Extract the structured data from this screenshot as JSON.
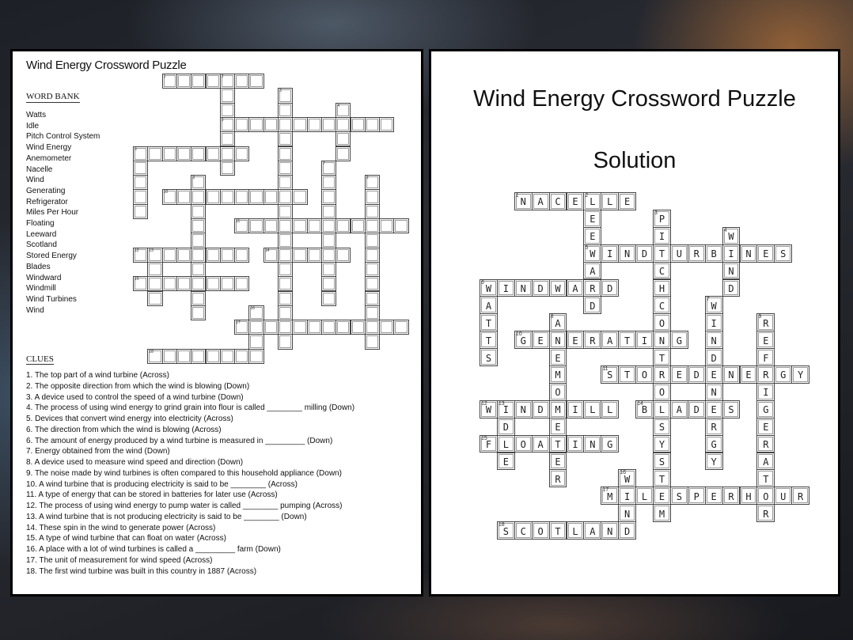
{
  "puzzle": {
    "title": "Wind Energy Crossword Puzzle",
    "word_bank_heading": "WORD BANK",
    "word_bank": [
      "Watts",
      "Idle",
      "Pitch Control System",
      "Wind Energy",
      "Anemometer",
      "Nacelle",
      "Wind",
      "Generating",
      "Refrigerator",
      "Miles Per Hour",
      "Floating",
      "Leeward",
      "Scotland",
      "Stored Energy",
      "Blades",
      "Windward",
      "Windmill",
      "Wind Turbines",
      "Wind"
    ],
    "clues_heading": "CLUES",
    "clues": [
      "1. The top part of a wind turbine (Across)",
      "2. The opposite direction from which the wind is blowing (Down)",
      "3. A device used to control the speed of a wind turbine (Down)",
      "4. The process of using wind energy to grind grain into flour is called ________ milling (Down)",
      "5. Devices that convert wind energy into electricity (Across)",
      "6. The direction from which the wind is blowing (Across)",
      "6. The amount of energy produced by a wind turbine is measured in _________ (Down)",
      "7. Energy obtained from the wind (Down)",
      "8. A device used to measure wind speed and direction (Down)",
      "9. The noise made by wind turbines is often compared to this household appliance (Down)",
      "10. A wind turbine that is producing electricity is said to be ________ (Across)",
      "11. A type of energy that can be stored in batteries for later use (Across)",
      "12. The process of using wind energy to pump water is called ________ pumping (Across)",
      "13. A wind turbine that is not producing electricity is said to be ________ (Down)",
      "14. These spin in the wind to generate power (Across)",
      "15. A type of wind turbine that can float on water (Across)",
      "16. A place with a lot of wind turbines is called a _________ farm (Down)",
      "17. The unit of measurement for wind speed (Across)",
      "18. The first wind turbine was built in this country in 1887 (Across)"
    ]
  },
  "solution": {
    "title": "Wind Energy Crossword Puzzle",
    "subtitle": "Solution"
  },
  "grid": {
    "words": [
      {
        "num": 1,
        "dir": "across",
        "row": 0,
        "col": 2,
        "answer": "NACELLE"
      },
      {
        "num": 2,
        "dir": "down",
        "row": 0,
        "col": 6,
        "answer": "LEEWARD"
      },
      {
        "num": 3,
        "dir": "down",
        "row": 1,
        "col": 10,
        "answer": "PITCHCONTROLSYSTEM"
      },
      {
        "num": 4,
        "dir": "down",
        "row": 2,
        "col": 14,
        "answer": "WIND"
      },
      {
        "num": 5,
        "dir": "across",
        "row": 3,
        "col": 6,
        "answer": "WINDTURBINES"
      },
      {
        "num": 6,
        "dir": "across",
        "row": 5,
        "col": 0,
        "answer": "WINDWARD"
      },
      {
        "num": 6,
        "dir": "down",
        "row": 5,
        "col": 0,
        "answer": "WATTS"
      },
      {
        "num": 7,
        "dir": "down",
        "row": 6,
        "col": 13,
        "answer": "WINDENERGY"
      },
      {
        "num": 8,
        "dir": "down",
        "row": 7,
        "col": 4,
        "answer": "ANEMOMETER"
      },
      {
        "num": 9,
        "dir": "down",
        "row": 7,
        "col": 16,
        "answer": "REFRIGERATOR"
      },
      {
        "num": 10,
        "dir": "across",
        "row": 8,
        "col": 2,
        "answer": "GENERATING"
      },
      {
        "num": 11,
        "dir": "across",
        "row": 10,
        "col": 7,
        "answer": "STOREDENERGY"
      },
      {
        "num": 12,
        "dir": "across",
        "row": 12,
        "col": 0,
        "answer": "WINDMILL"
      },
      {
        "num": 13,
        "dir": "down",
        "row": 12,
        "col": 1,
        "answer": "IDLE"
      },
      {
        "num": 14,
        "dir": "across",
        "row": 12,
        "col": 9,
        "answer": "BLADES"
      },
      {
        "num": 15,
        "dir": "across",
        "row": 14,
        "col": 0,
        "answer": "FLOATING"
      },
      {
        "num": 16,
        "dir": "down",
        "row": 16,
        "col": 8,
        "answer": "WIND"
      },
      {
        "num": 17,
        "dir": "across",
        "row": 17,
        "col": 7,
        "answer": "MILESPERHOUR"
      },
      {
        "num": 18,
        "dir": "across",
        "row": 19,
        "col": 1,
        "answer": "SCOTLAND"
      }
    ]
  }
}
